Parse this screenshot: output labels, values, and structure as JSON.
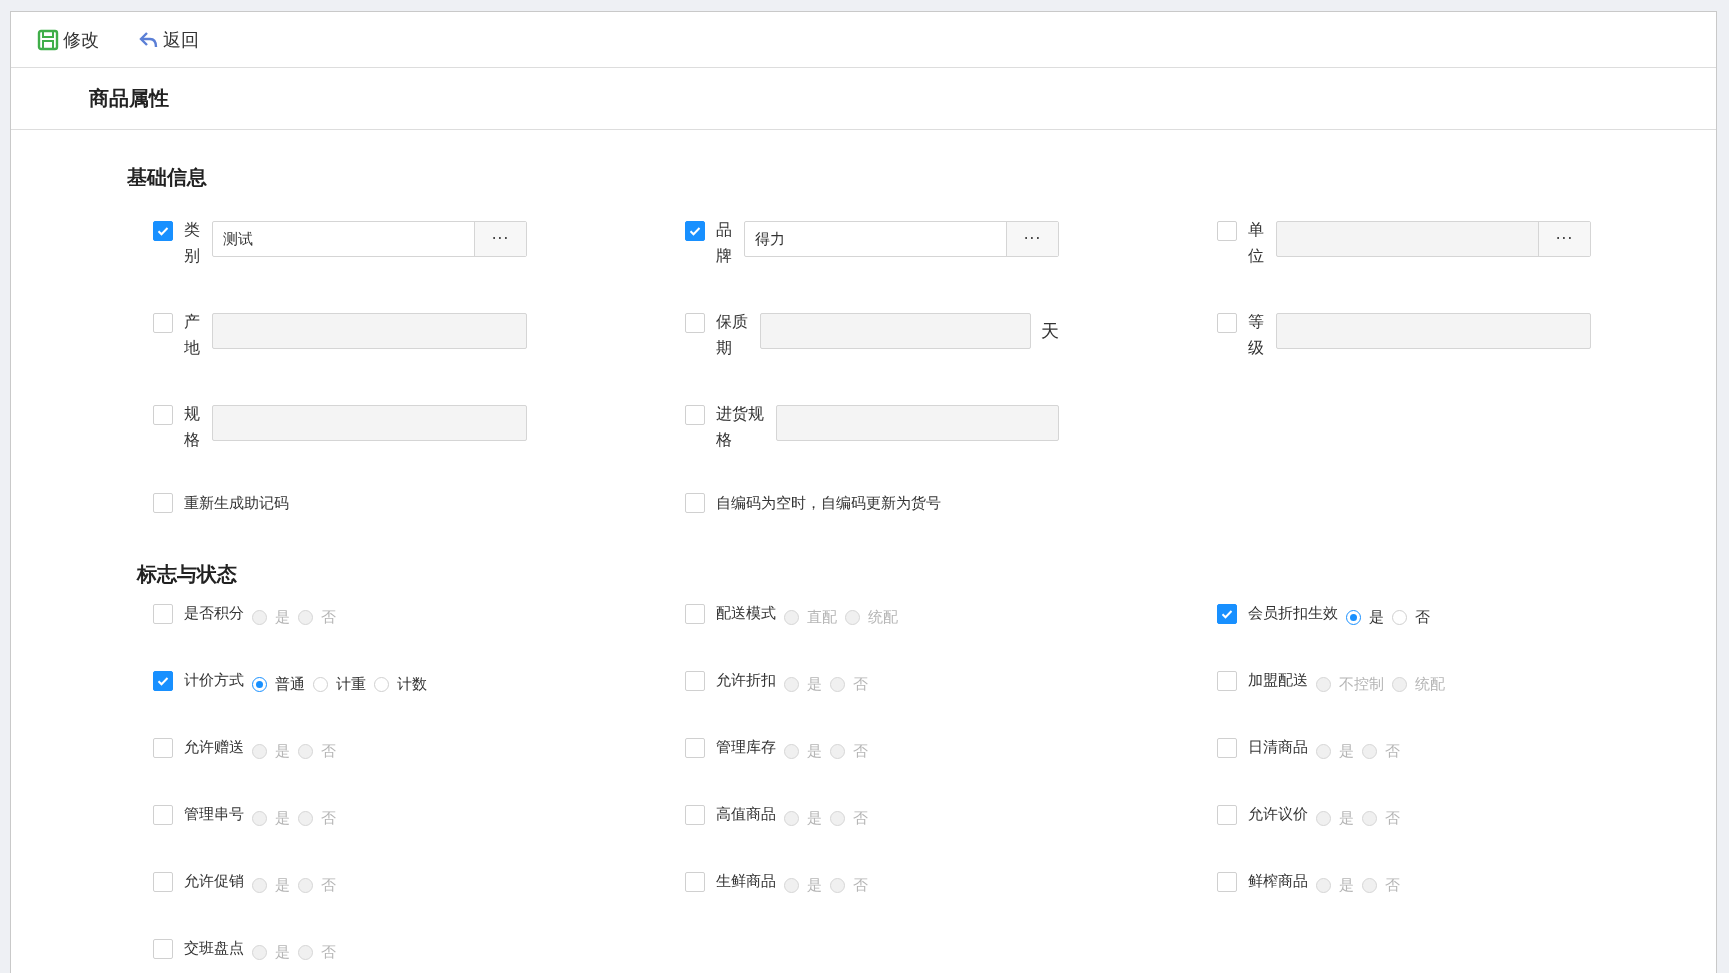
{
  "toolbar": {
    "buttons": [
      {
        "label": "修改",
        "kind": "save"
      },
      {
        "label": "返回",
        "kind": "back"
      }
    ]
  },
  "page_title": "商品属性",
  "basic_info": {
    "title": "基础信息",
    "fields": [
      {
        "label": "类别",
        "checked": true,
        "value": "测试",
        "kind": "picker",
        "picker_button": "···"
      },
      {
        "label": "品牌",
        "checked": true,
        "value": "得力",
        "kind": "picker",
        "picker_button": "···"
      },
      {
        "label": "单位",
        "checked": false,
        "kind": "picker",
        "picker_button": "···"
      },
      {
        "label": "产地",
        "checked": false,
        "kind": "text"
      },
      {
        "label": "保质期",
        "checked": false,
        "kind": "text",
        "suffix": "天"
      },
      {
        "label": "等级",
        "checked": false,
        "kind": "text"
      },
      {
        "label": "规格",
        "checked": false,
        "kind": "text"
      },
      {
        "label": "进货规格",
        "checked": false,
        "kind": "text"
      }
    ],
    "options": [
      {
        "label": "重新生成助记码",
        "checked": false
      },
      {
        "label": "自编码为空时，自编码更新为货号",
        "checked": false
      }
    ]
  },
  "flags": {
    "title": "标志与状态",
    "items": [
      {
        "label": "是否积分",
        "checked": false,
        "options": [
          {
            "label": "是",
            "selected": false
          },
          {
            "label": "否",
            "selected": false
          }
        ]
      },
      {
        "label": "配送模式",
        "checked": false,
        "options": [
          {
            "label": "直配",
            "selected": false
          },
          {
            "label": "统配",
            "selected": false
          }
        ]
      },
      {
        "label": "会员折扣生效",
        "checked": true,
        "options": [
          {
            "label": "是",
            "selected": true
          },
          {
            "label": "否",
            "selected": false
          }
        ]
      },
      {
        "label": "计价方式",
        "checked": true,
        "options": [
          {
            "label": "普通",
            "selected": true
          },
          {
            "label": "计重",
            "selected": false
          },
          {
            "label": "计数",
            "selected": false
          }
        ]
      },
      {
        "label": "允许折扣",
        "checked": false,
        "options": [
          {
            "label": "是",
            "selected": false
          },
          {
            "label": "否",
            "selected": false
          }
        ]
      },
      {
        "label": "加盟配送",
        "checked": false,
        "options": [
          {
            "label": "不控制",
            "selected": false
          },
          {
            "label": "统配",
            "selected": false
          }
        ]
      },
      {
        "label": "允许赠送",
        "checked": false,
        "options": [
          {
            "label": "是",
            "selected": false
          },
          {
            "label": "否",
            "selected": false
          }
        ]
      },
      {
        "label": "管理库存",
        "checked": false,
        "options": [
          {
            "label": "是",
            "selected": false
          },
          {
            "label": "否",
            "selected": false
          }
        ]
      },
      {
        "label": "日清商品",
        "checked": false,
        "options": [
          {
            "label": "是",
            "selected": false
          },
          {
            "label": "否",
            "selected": false
          }
        ]
      },
      {
        "label": "管理串号",
        "checked": false,
        "options": [
          {
            "label": "是",
            "selected": false
          },
          {
            "label": "否",
            "selected": false
          }
        ]
      },
      {
        "label": "高值商品",
        "checked": false,
        "options": [
          {
            "label": "是",
            "selected": false
          },
          {
            "label": "否",
            "selected": false
          }
        ]
      },
      {
        "label": "允许议价",
        "checked": false,
        "options": [
          {
            "label": "是",
            "selected": false
          },
          {
            "label": "否",
            "selected": false
          }
        ]
      },
      {
        "label": "允许促销",
        "checked": false,
        "options": [
          {
            "label": "是",
            "selected": false
          },
          {
            "label": "否",
            "selected": false
          }
        ]
      },
      {
        "label": "生鲜商品",
        "checked": false,
        "options": [
          {
            "label": "是",
            "selected": false
          },
          {
            "label": "否",
            "selected": false
          }
        ]
      },
      {
        "label": "鲜榨商品",
        "checked": false,
        "options": [
          {
            "label": "是",
            "selected": false
          },
          {
            "label": "否",
            "selected": false
          }
        ]
      },
      {
        "label": "交班盘点",
        "checked": false,
        "options": [
          {
            "label": "是",
            "selected": false
          },
          {
            "label": "否",
            "selected": false
          }
        ]
      }
    ]
  }
}
